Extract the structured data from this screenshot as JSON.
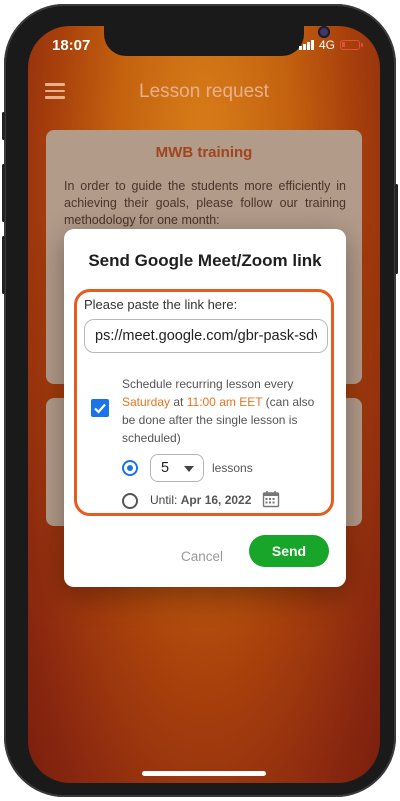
{
  "status_bar": {
    "time": "18:07",
    "network": "4G"
  },
  "app_bar": {
    "title": "Lesson request",
    "menu_icon": "hamburger-menu-icon"
  },
  "background_card": {
    "title": "MWB training",
    "body": "In order to guide the students more efficiently in achieving their goals, please follow our training methodology for one month:"
  },
  "dialog": {
    "title": "Send Google Meet/Zoom link",
    "paste_label": "Please paste the link here:",
    "link_value": "ps://meet.google.com/gbr-pask-sdv",
    "recurring": {
      "checked": true,
      "text_before": "Schedule recurring lesson every ",
      "day": "Saturday",
      "text_at": " at ",
      "time": "11:00 am EET",
      "text_after": " (can also be done after the single lesson is scheduled)"
    },
    "count_option": {
      "selected": true,
      "value": "5",
      "suffix": "lessons"
    },
    "until_option": {
      "selected": false,
      "label": "Until:",
      "date": "Apr 16, 2022",
      "icon": "calendar-icon"
    },
    "cancel_label": "Cancel",
    "send_label": "Send"
  },
  "colors": {
    "accent_blue": "#1a73e8",
    "send_green": "#17a62a",
    "highlight_orange": "#e85b1e",
    "text_orange": "#e8741e"
  }
}
